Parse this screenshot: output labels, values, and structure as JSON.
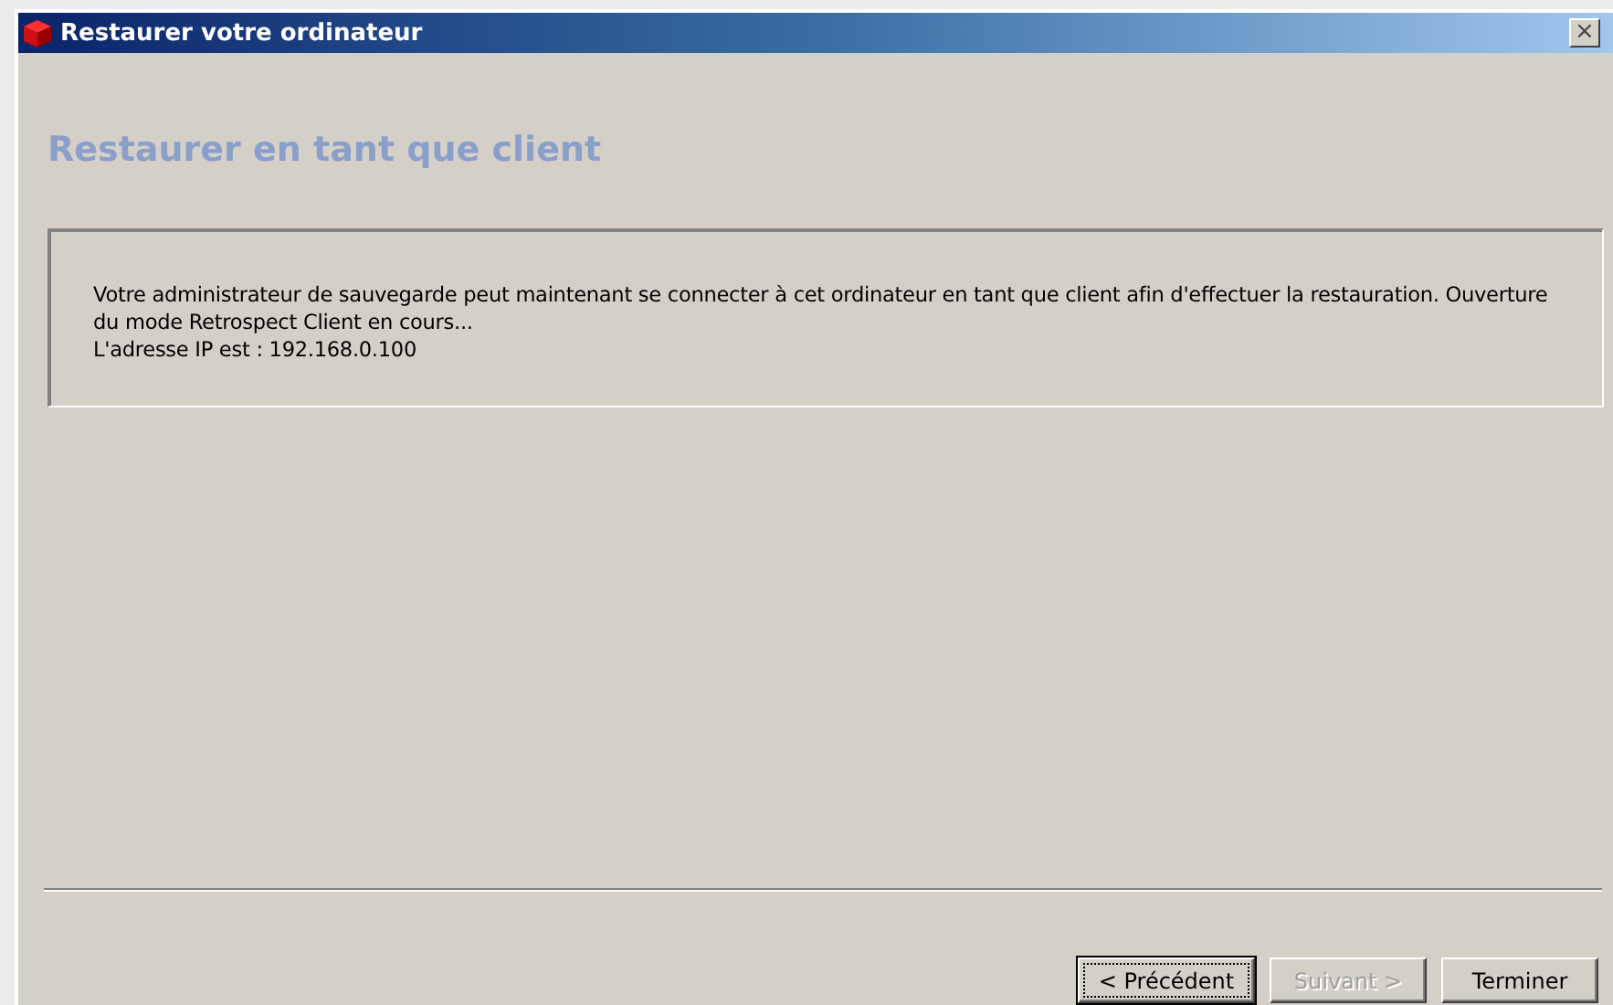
{
  "window": {
    "title": "Restaurer votre ordinateur",
    "close": "×"
  },
  "heading": "Restaurer en tant que client",
  "message": {
    "lines": [
      "Votre administrateur de sauvegarde peut maintenant se connecter à cet ordinateur en tant que client afin d'effectuer la restauration. Ouverture du mode Retrospect Client en cours...",
      "L'adresse IP est : 192.168.0.100"
    ]
  },
  "buttons": [
    {
      "label": "< Précédent",
      "disabled": false,
      "focused": true
    },
    {
      "label": "Suivant >",
      "disabled": true,
      "focused": false
    },
    {
      "label": "Terminer",
      "disabled": false,
      "focused": false
    }
  ]
}
